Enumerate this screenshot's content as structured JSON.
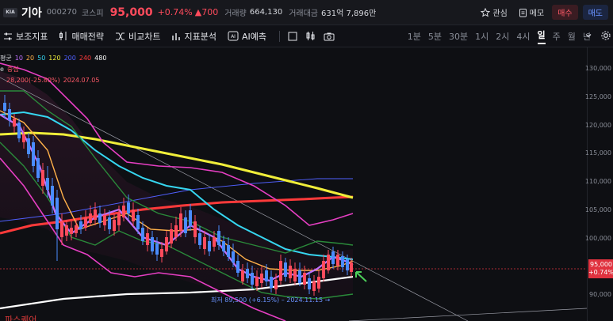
{
  "header": {
    "name": "기아",
    "code": "000270",
    "market": "코스피",
    "price": "95,000",
    "change_pct": "+0.74%",
    "change_amt": "▲700",
    "volume_label": "거래량",
    "volume": "664,130",
    "amount_label": "거래대금",
    "amount": "631억 7,896만",
    "watch_label": "관심",
    "memo_label": "메모",
    "buy_label": "매수",
    "sell_label": "매도"
  },
  "toolbar": {
    "aux_indicator": "보조지표",
    "trade_strategy": "매매전략",
    "compare_chart": "비교차트",
    "indicator_analysis": "지표분석",
    "ai_forecast": "AI예측",
    "periods": [
      "1분",
      "5분",
      "30분",
      "1시",
      "2시",
      "4시",
      "일",
      "주",
      "월",
      "년"
    ],
    "active_period": "일"
  },
  "legend": {
    "ma_label": "평균",
    "ma_values": [
      {
        "text": "10",
        "color": "#c070ff"
      },
      {
        "text": "20",
        "color": "#ffb14a"
      },
      {
        "text": "50",
        "color": "#36d6f0"
      },
      {
        "text": "120",
        "color": "#f0ee3a"
      },
      {
        "text": "200",
        "color": "#5060ff"
      },
      {
        "text": "240",
        "color": "#ff3a3a"
      },
      {
        "text": "480",
        "color": "#ffffff"
      }
    ],
    "line2_a": "e",
    "line2_b": "중심",
    "line3_a": "28,200(-25.80%)",
    "line3_b": "2024.07.05"
  },
  "axis": {
    "ticks": [
      "130,000",
      "125,000",
      "120,000",
      "115,000",
      "110,000",
      "105,000",
      "100,000",
      "95,000",
      "90,000"
    ],
    "last_price": "95,000",
    "last_change": "+0.74%"
  },
  "low_label": "최저 89,500 (+6.15%) – 2024.11.15 →",
  "bottom_text": "파스퀘어",
  "colors": {
    "up": "#ff4b5c",
    "down": "#4a8cff",
    "ma10": "#c070ff",
    "ma20": "#ffb14a",
    "ma50": "#36d6f0",
    "ma120": "#f0ee3a",
    "ma200": "#5060ff",
    "ma240": "#ff3a3a",
    "ma480": "#ffffff"
  }
}
